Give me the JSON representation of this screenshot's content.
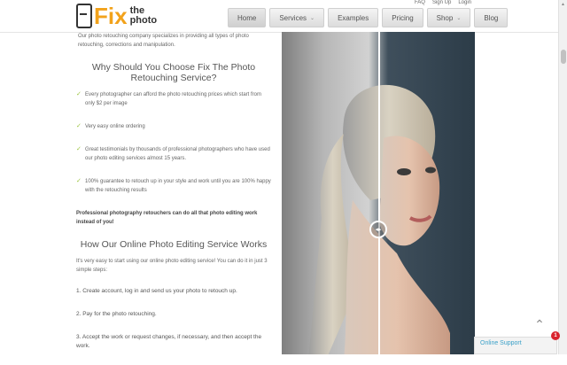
{
  "header": {
    "logo": {
      "fix": "Fix",
      "the": "the",
      "photo": "photo"
    },
    "top_links": [
      "FAQ",
      "Sign Up",
      "Login"
    ],
    "nav": [
      {
        "label": "Home",
        "caret": false
      },
      {
        "label": "Services",
        "caret": true
      },
      {
        "label": "Examples",
        "caret": false
      },
      {
        "label": "Pricing",
        "caret": false
      },
      {
        "label": "Shop",
        "caret": true
      },
      {
        "label": "Blog",
        "caret": false
      }
    ]
  },
  "content": {
    "intro": "Our photo retouching company specializes in providing all types of photo retouching, corrections and manipulation.",
    "why_title": "Why Should You Choose Fix The Photo Retouching Service?",
    "bullets": [
      "Every photographer can afford the photo retouching prices which start from only $2 per image",
      "Very easy online ordering",
      "Great testimonials by thousands of professional photographers who have used our photo editing services almost 15 years.",
      "100% guarantee to retouch up in your style and work until you are 100% happy with the retouching results"
    ],
    "strong_text": "Professional photography retouchers can do all that photo editing work instead of you!",
    "how_title": "How Our Online Photo Editing Service Works",
    "how_intro": "It's very easy to start using our online photo editing service! You can do it in just 3 simple steps:",
    "steps": [
      "1. Create account, log in and send us your photo to retouch up.",
      "2. Pay for the photo retouching.",
      "3. Accept the work or request changes, if necessary, and then accept the work."
    ]
  },
  "widgets": {
    "online_support": "Online Support",
    "badge_count": "1"
  },
  "colors": {
    "accent": "#f2a21b",
    "check": "#9bc43e",
    "support": "#3aa0c8",
    "badge": "#d9232d"
  },
  "icons": {
    "check": "check-icon",
    "to_top": "chevron-up-icon",
    "handle": "compare-arrows-icon"
  }
}
